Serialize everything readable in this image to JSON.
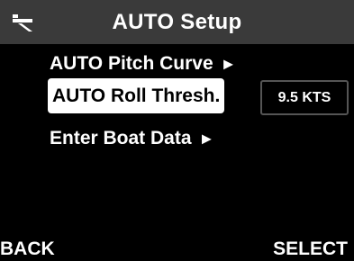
{
  "title_bar": {
    "title": "AUTO Setup",
    "icon": "trim-tab-icon"
  },
  "menu": {
    "items": [
      {
        "label": "AUTO Pitch Curve",
        "arrow": "►",
        "selected": false
      },
      {
        "label": "AUTO Roll Thresh.",
        "value": "9.5 KTS",
        "selected": true
      },
      {
        "label": "Enter Boat Data",
        "arrow": "►",
        "selected": false
      }
    ]
  },
  "softkeys": {
    "left": "BACK",
    "right": "SELECT"
  },
  "colors": {
    "background": "#000000",
    "title_bar": "#3a3a3a",
    "highlight": "#ffffff",
    "text": "#ffffff"
  }
}
